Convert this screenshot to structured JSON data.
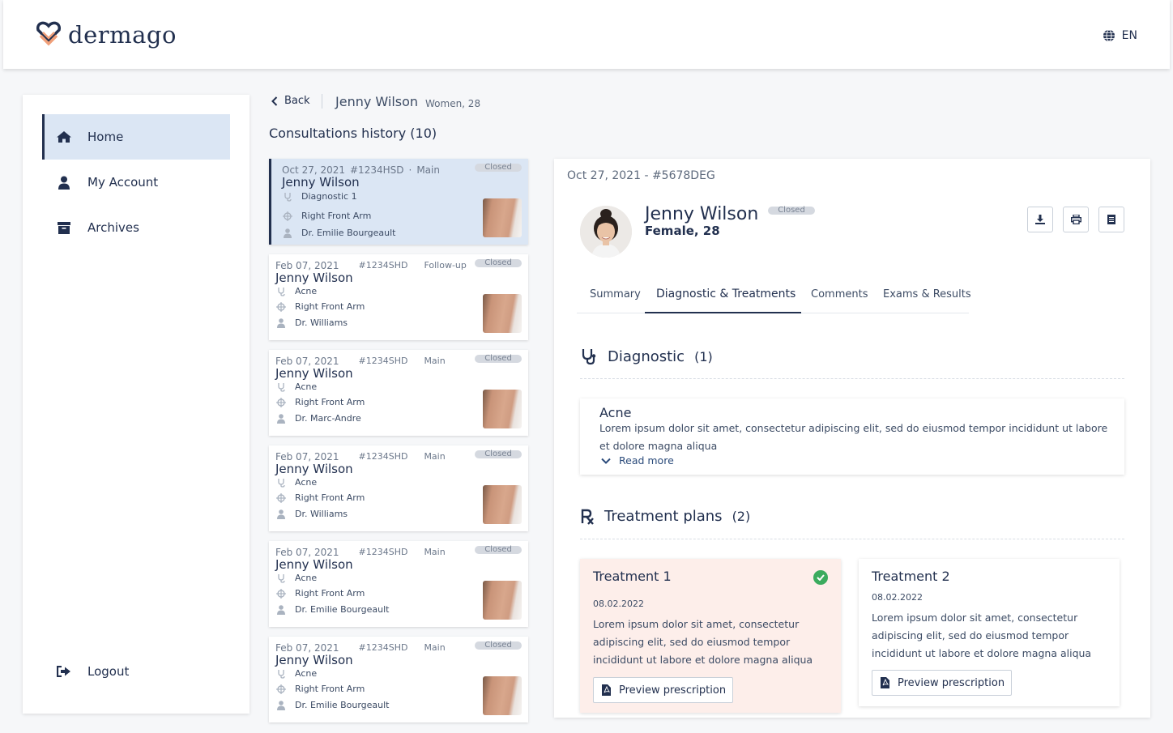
{
  "app": {
    "brand": "dermago",
    "language": "EN"
  },
  "sidebar": {
    "items": [
      {
        "label": "Home",
        "icon": "home-icon",
        "active": true
      },
      {
        "label": "My Account",
        "icon": "user-icon"
      },
      {
        "label": "Archives",
        "icon": "archive-icon"
      }
    ],
    "logout_label": "Logout"
  },
  "header": {
    "back_label": "Back",
    "patient_name": "Jenny Wilson",
    "patient_info": "Women, 28"
  },
  "history": {
    "title": "Consultations history (10)",
    "consultations": [
      {
        "date": "Oct 27, 2021",
        "id": "#1234HSD",
        "type": "Main",
        "status": "Closed",
        "name": "Jenny Wilson",
        "diagnostic": "Diagnostic 1",
        "location": "Right Front Arm",
        "doctor": "Dr. Emilie Bourgeault"
      },
      {
        "date": "Feb 07, 2021",
        "id": "#1234SHD",
        "type": "Follow-up",
        "status": "Closed",
        "name": "Jenny Wilson",
        "diagnostic": "Acne",
        "location": "Right Front Arm",
        "doctor": "Dr. Williams"
      },
      {
        "date": "Feb 07, 2021",
        "id": "#1234SHD",
        "type": "Main",
        "status": "Closed",
        "name": "Jenny Wilson",
        "diagnostic": "Acne",
        "location": "Right Front Arm",
        "doctor": "Dr. Marc-Andre"
      },
      {
        "date": "Feb 07, 2021",
        "id": "#1234SHD",
        "type": "Main",
        "status": "Closed",
        "name": "Jenny Wilson",
        "diagnostic": "Acne",
        "location": "Right Front Arm",
        "doctor": "Dr. Williams"
      },
      {
        "date": "Feb 07, 2021",
        "id": "#1234SHD",
        "type": "Main",
        "status": "Closed",
        "name": "Jenny Wilson",
        "diagnostic": "Acne",
        "location": "Right Front Arm",
        "doctor": "Dr. Emilie Bourgeault"
      },
      {
        "date": "Feb 07, 2021",
        "id": "#1234SHD",
        "type": "Main",
        "status": "Closed",
        "name": "Jenny Wilson",
        "diagnostic": "Acne",
        "location": "Right Front Arm",
        "doctor": "Dr. Emilie Bourgeault"
      }
    ]
  },
  "detail": {
    "heading": "Oct 27, 2021 - #5678DEG",
    "name": "Jenny Wilson",
    "sub": "Female, 28",
    "status": "Closed",
    "tabs": [
      "Summary",
      "Diagnostic & Treatments",
      "Comments",
      "Exams & Results"
    ],
    "active_tab": "Diagnostic & Treatments",
    "diagnostic": {
      "title": "Diagnostic",
      "count": "(1)",
      "item_title": "Acne",
      "item_text": "Lorem ipsum dolor sit amet, consectetur adipiscing elit, sed do eiusmod tempor incididunt ut labore et dolore magna aliqua",
      "read_more": "Read more"
    },
    "treatments": {
      "title": "Treatment plans",
      "count": "(2)",
      "plans": [
        {
          "title": "Treatment 1",
          "date": "08.02.2022",
          "text": "Lorem ipsum dolor sit amet, consectetur adipiscing elit, sed do eiusmod tempor incididunt ut labore et dolore magna aliqua",
          "button": "Preview prescription",
          "selected": true
        },
        {
          "title": "Treatment 2",
          "date": "08.02.2022",
          "text": "Lorem ipsum dolor sit amet, consectetur adipiscing elit, sed do eiusmod tempor incididunt ut labore et dolore magna aliqua",
          "button": "Preview prescription",
          "selected": false
        }
      ]
    }
  },
  "colors": {
    "primary": "#22304f",
    "active_bg": "#dbe6f4",
    "selected_plan_bg": "#fdeeea",
    "success": "#3bab5e",
    "brand_accent": "#f0a07a"
  }
}
